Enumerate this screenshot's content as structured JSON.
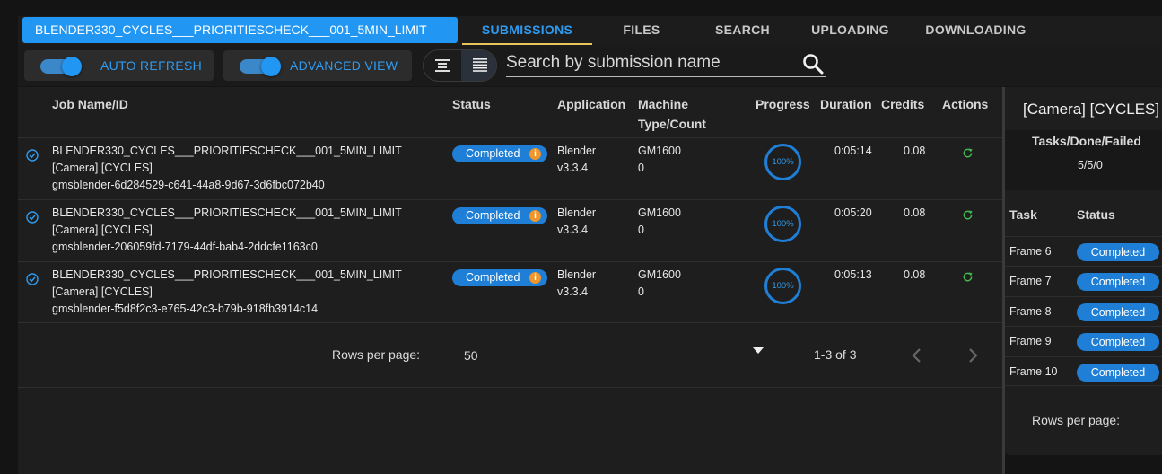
{
  "header": {
    "project_name": "BLENDER330_CYCLES___PRIORITIESCHECK___001_5MIN_LIMIT",
    "tabs": [
      {
        "label": "SUBMISSIONS",
        "active": true
      },
      {
        "label": "FILES",
        "active": false
      },
      {
        "label": "SEARCH",
        "active": false
      },
      {
        "label": "UPLOADING",
        "active": false
      },
      {
        "label": "DOWNLOADING",
        "active": false
      }
    ]
  },
  "toolbar": {
    "auto_refresh_label": "AUTO REFRESH",
    "auto_refresh_on": true,
    "advanced_view_label": "ADVANCED VIEW",
    "advanced_view_on": true,
    "search_placeholder": "Search by submission name"
  },
  "table": {
    "columns": {
      "job": "Job Name/ID",
      "status": "Status",
      "application": "Application",
      "machine": "Machine Type/Count",
      "progress": "Progress",
      "duration": "Duration",
      "credits": "Credits",
      "actions": "Actions"
    },
    "rows": [
      {
        "name": "BLENDER330_CYCLES___PRIORITIESCHECK___001_5MIN_LIMIT [Camera] [CYCLES]",
        "id": "gmsblender-6d284529-c641-44a8-9d67-3d6fbc072b40",
        "status": "Completed",
        "app": "Blender",
        "app_version": "v3.3.4",
        "machine_type": "GM1600",
        "machine_count": "0",
        "progress": "100%",
        "duration": "0:05:14",
        "credits": "0.08"
      },
      {
        "name": "BLENDER330_CYCLES___PRIORITIESCHECK___001_5MIN_LIMIT [Camera] [CYCLES]",
        "id": "gmsblender-206059fd-7179-44df-bab4-2ddcfe1163c0",
        "status": "Completed",
        "app": "Blender",
        "app_version": "v3.3.4",
        "machine_type": "GM1600",
        "machine_count": "0",
        "progress": "100%",
        "duration": "0:05:20",
        "credits": "0.08"
      },
      {
        "name": "BLENDER330_CYCLES___PRIORITIESCHECK___001_5MIN_LIMIT [Camera] [CYCLES]",
        "id": "gmsblender-f5d8f2c3-e765-42c3-b79b-918fb3914c14",
        "status": "Completed",
        "app": "Blender",
        "app_version": "v3.3.4",
        "machine_type": "GM1600",
        "machine_count": "0",
        "progress": "100%",
        "duration": "0:05:13",
        "credits": "0.08"
      }
    ]
  },
  "pagination": {
    "rows_per_page_label": "Rows per page:",
    "rows_per_page": "50",
    "range": "1-3 of 3"
  },
  "side_panel": {
    "title": "[Camera] [CYCLES] -",
    "tasks_done_failed_label": "Tasks/Done/Failed",
    "tasks_done_failed_value": "5/5/0",
    "columns": {
      "task": "Task",
      "status": "Status"
    },
    "tasks": [
      {
        "name": "Frame 6",
        "status": "Completed"
      },
      {
        "name": "Frame 7",
        "status": "Completed"
      },
      {
        "name": "Frame 8",
        "status": "Completed"
      },
      {
        "name": "Frame 9",
        "status": "Completed"
      },
      {
        "name": "Frame 10",
        "status": "Completed"
      }
    ],
    "rows_per_page_label": "Rows per page:"
  },
  "colors": {
    "accent": "#2196f3",
    "status_badge": "#1f7fd6",
    "info": "#f0962a",
    "refresh": "#3fb950",
    "active_tab_underline": "#e6c65a"
  }
}
